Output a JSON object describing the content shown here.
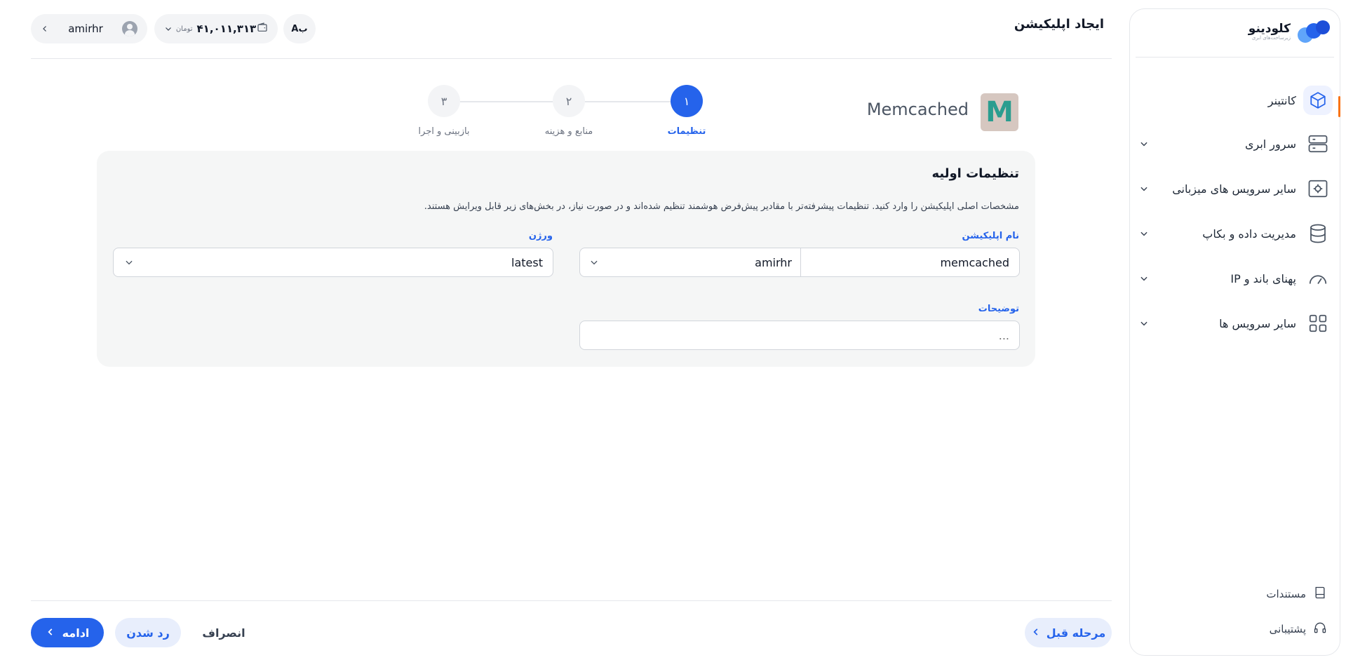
{
  "sidebar": {
    "logo": {
      "name": "کلودینو",
      "tagline": "زیرساخت‌های ابری"
    },
    "items": [
      {
        "label": "کانتینر",
        "icon": "container-box-icon",
        "active": true
      },
      {
        "label": "سرور ابری",
        "icon": "server-icon",
        "active": false
      },
      {
        "label": "سایر سرویس های میزبانی",
        "icon": "hosting-gear-icon",
        "active": false
      },
      {
        "label": "مدیریت داده و بکاپ",
        "icon": "database-icon",
        "active": false
      },
      {
        "label": "پهنای باند و IP",
        "icon": "speedometer-icon",
        "active": false
      },
      {
        "label": "سایر سرویس ها",
        "icon": "grid-apps-icon",
        "active": false
      }
    ],
    "docs_label": "مستندات",
    "support_label": "پشتیبانی",
    "accent_color": "#f97316"
  },
  "header": {
    "title": "ایجاد اپلیکیشن",
    "username": "amirhr",
    "wallet_amount": "۴۱,۰۱۱,۳۱۳",
    "wallet_unit": "تومان",
    "lang_toggle": "Aب"
  },
  "app": {
    "name": "Memcached",
    "logo_letter": "M"
  },
  "stepper": [
    {
      "number": "۱",
      "label": "تنظیمات",
      "active": true
    },
    {
      "number": "۲",
      "label": "منابع و هزینه",
      "active": false
    },
    {
      "number": "۳",
      "label": "بازبینی و اجرا",
      "active": false
    }
  ],
  "form": {
    "title": "تنظیمات اولیه",
    "description": "مشخصات اصلی اپلیکیشن را وارد کنید. تنظیمات پیشرفته‌تر با مقادیر پیش‌فرض هوشمند تنظیم شده‌اند و در صورت نیاز، در بخش‌های زیر قابل ویرایش هستند.",
    "app_name_label": "نام اپلیکیشن",
    "app_name_value": "memcached",
    "namespace_value": "amirhr",
    "version_label": "ورژن",
    "version_value": "latest",
    "description_label": "توضیحات",
    "description_placeholder": "..."
  },
  "footer": {
    "continue_label": "ادامه",
    "reject_label": "رد شدن",
    "cancel_label": "انصراف",
    "prev_label": "مرحله قبل"
  },
  "colors": {
    "primary": "#2563eb",
    "card_bg": "#f5f6f6",
    "memcached_logo_bg": "#d6c7c0",
    "memcached_logo_fg": "#2a9d8f"
  }
}
